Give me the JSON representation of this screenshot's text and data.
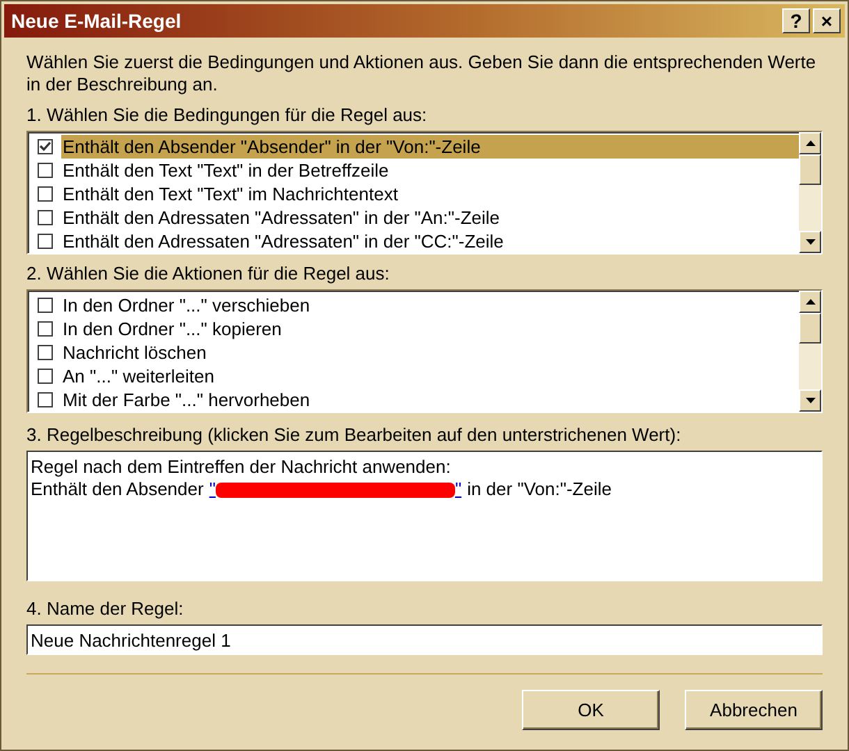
{
  "window": {
    "title": "Neue E-Mail-Regel",
    "title_buttons": [
      "?",
      "×"
    ]
  },
  "intro": "Wählen Sie zuerst die Bedingungen und Aktionen aus. Geben Sie dann die entsprechenden Werte in der Beschreibung an.",
  "conditions": {
    "label": "1. Wählen Sie die Bedingungen für die Regel aus:",
    "items": [
      {
        "text": "Enthält den Absender \"Absender\" in der \"Von:\"-Zeile",
        "checked": true,
        "selected": true
      },
      {
        "text": "Enthält den Text \"Text\" in der Betreffzeile",
        "checked": false,
        "selected": false
      },
      {
        "text": "Enthält den Text \"Text\" im Nachrichtentext",
        "checked": false,
        "selected": false
      },
      {
        "text": "Enthält den Adressaten \"Adressaten\" in der \"An:\"-Zeile",
        "checked": false,
        "selected": false
      },
      {
        "text": "Enthält den Adressaten \"Adressaten\" in der \"CC:\"-Zeile",
        "checked": false,
        "selected": false
      }
    ]
  },
  "actions": {
    "label": "2. Wählen Sie die Aktionen für die Regel aus:",
    "items": [
      {
        "text": "In den Ordner \"...\" verschieben",
        "checked": false,
        "selected": false
      },
      {
        "text": "In den Ordner \"...\" kopieren",
        "checked": false,
        "selected": false
      },
      {
        "text": "Nachricht löschen",
        "checked": false,
        "selected": false
      },
      {
        "text": "An \"...\" weiterleiten",
        "checked": false,
        "selected": false
      },
      {
        "text": "Mit der Farbe \"...\" hervorheben",
        "checked": false,
        "selected": false
      }
    ]
  },
  "description": {
    "label": "3. Regelbeschreibung (klicken Sie zum Bearbeiten auf den unterstrichenen Wert):",
    "line_1": "Regel nach dem Eintreffen der Nachricht anwenden:",
    "line_2_before": "Enthält den Absender",
    "link_open": "\"",
    "link_close": "\"",
    "line_2_after": "in der \"Von:\"-Zeile"
  },
  "name": {
    "label": "4. Name der Regel:",
    "value": "Neue Nachrichtenregel 1"
  },
  "buttons": [
    "OK",
    "Abbrechen"
  ]
}
